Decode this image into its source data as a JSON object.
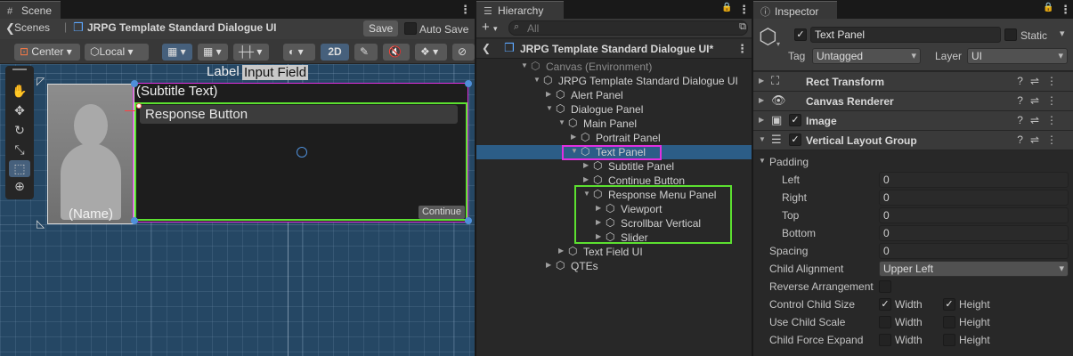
{
  "scene": {
    "tab_label": "Scene",
    "prefab_title": "JRPG Template Standard Dialogue UI",
    "save_label": "Save",
    "auto_save_label": "Auto Save",
    "pivot_mode": "Center",
    "space_mode": "Local",
    "mode_2d": "2D",
    "label_text": "Label",
    "input_field_text": "Input Field",
    "subtitle_text": "(Subtitle Text)",
    "response_button_text": "Response Button",
    "name_text": "(Name)",
    "continue_text": "Continue"
  },
  "hierarchy": {
    "tab_label": "Hierarchy",
    "search_placeholder": "All",
    "prefab_root": "JRPG Template Standard Dialogue UI*",
    "rows": [
      {
        "label": "Canvas (Environment)"
      },
      {
        "label": "JRPG Template Standard Dialogue UI"
      },
      {
        "label": "Alert Panel"
      },
      {
        "label": "Dialogue Panel"
      },
      {
        "label": "Main Panel"
      },
      {
        "label": "Portrait Panel"
      },
      {
        "label": "Text Panel"
      },
      {
        "label": "Subtitle Panel"
      },
      {
        "label": "Continue Button"
      },
      {
        "label": "Response Menu Panel"
      },
      {
        "label": "Viewport"
      },
      {
        "label": "Scrollbar Vertical"
      },
      {
        "label": "Slider"
      },
      {
        "label": "Text Field UI"
      },
      {
        "label": "QTEs"
      }
    ]
  },
  "inspector": {
    "tab_label": "Inspector",
    "object_name": "Text Panel",
    "static_label": "Static",
    "tag_label": "Tag",
    "tag_value": "Untagged",
    "layer_label": "Layer",
    "layer_value": "UI",
    "components": [
      {
        "title": "Rect Transform"
      },
      {
        "title": "Canvas Renderer"
      },
      {
        "title": "Image"
      },
      {
        "title": "Vertical Layout Group"
      }
    ],
    "padding_label": "Padding",
    "left_label": "Left",
    "left_value": "0",
    "right_label": "Right",
    "right_value": "0",
    "top_label": "Top",
    "top_value": "0",
    "bottom_label": "Bottom",
    "bottom_value": "0",
    "spacing_label": "Spacing",
    "spacing_value": "0",
    "child_alignment_label": "Child Alignment",
    "child_alignment_value": "Upper Left",
    "reverse_label": "Reverse Arrangement",
    "control_size_label": "Control Child Size",
    "use_scale_label": "Use Child Scale",
    "force_expand_label": "Child Force Expand",
    "width_label": "Width",
    "height_label": "Height"
  },
  "colors": {
    "highlight_magenta": "#e030e0",
    "highlight_green": "#5ce030",
    "selection_blue": "#2c5d87",
    "scene_bg": "#254764"
  }
}
